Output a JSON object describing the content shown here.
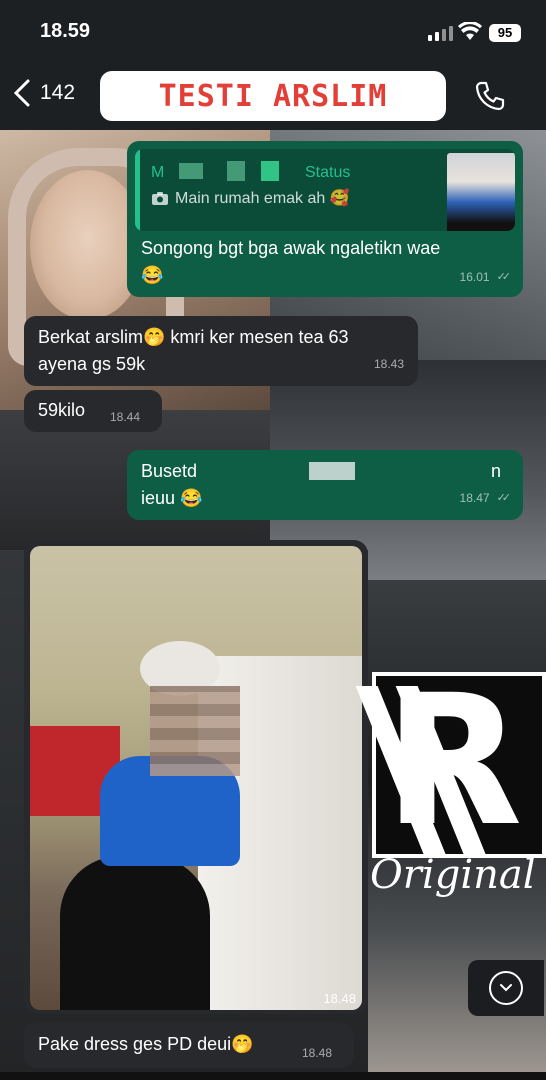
{
  "status_bar": {
    "time": "18.59",
    "battery": "95"
  },
  "header": {
    "back_count": "142",
    "title": "TESTI ARSLIM"
  },
  "messages": [
    {
      "direction": "out",
      "quote": {
        "author": "M",
        "label": "Status",
        "text": "Main rumah emak ah 🥰"
      },
      "text": "Songong bgt bga awak ngaletikn wae",
      "emoji": "😂",
      "time": "16.01"
    },
    {
      "direction": "in",
      "text_line1": "Berkat arslim🤭 kmri ker mesen tea 63",
      "text_line2": "ayena gs 59k",
      "time": "18.43"
    },
    {
      "direction": "in",
      "text": "59kilo",
      "time": "18.44"
    },
    {
      "direction": "out",
      "text_line1": "Busetd",
      "text_line1_tail": "n",
      "text_line2": "ieuu",
      "emoji": "😂",
      "time": "18.47"
    },
    {
      "direction": "in",
      "type": "photo",
      "time": "18.48"
    },
    {
      "direction": "in",
      "text": "Pake dress ges PD deui🤭",
      "time": "18.48"
    }
  ],
  "logo": {
    "mark": "R",
    "text": "Original"
  },
  "icons": {
    "back": "chevron-left-icon",
    "call": "phone-icon",
    "scroll": "chevron-down-icon",
    "camera": "camera-icon"
  },
  "colors": {
    "outgoing": "#0e5e45",
    "incoming": "#27292c",
    "title_red": "#e23f38",
    "quote_green": "#23c08a"
  }
}
